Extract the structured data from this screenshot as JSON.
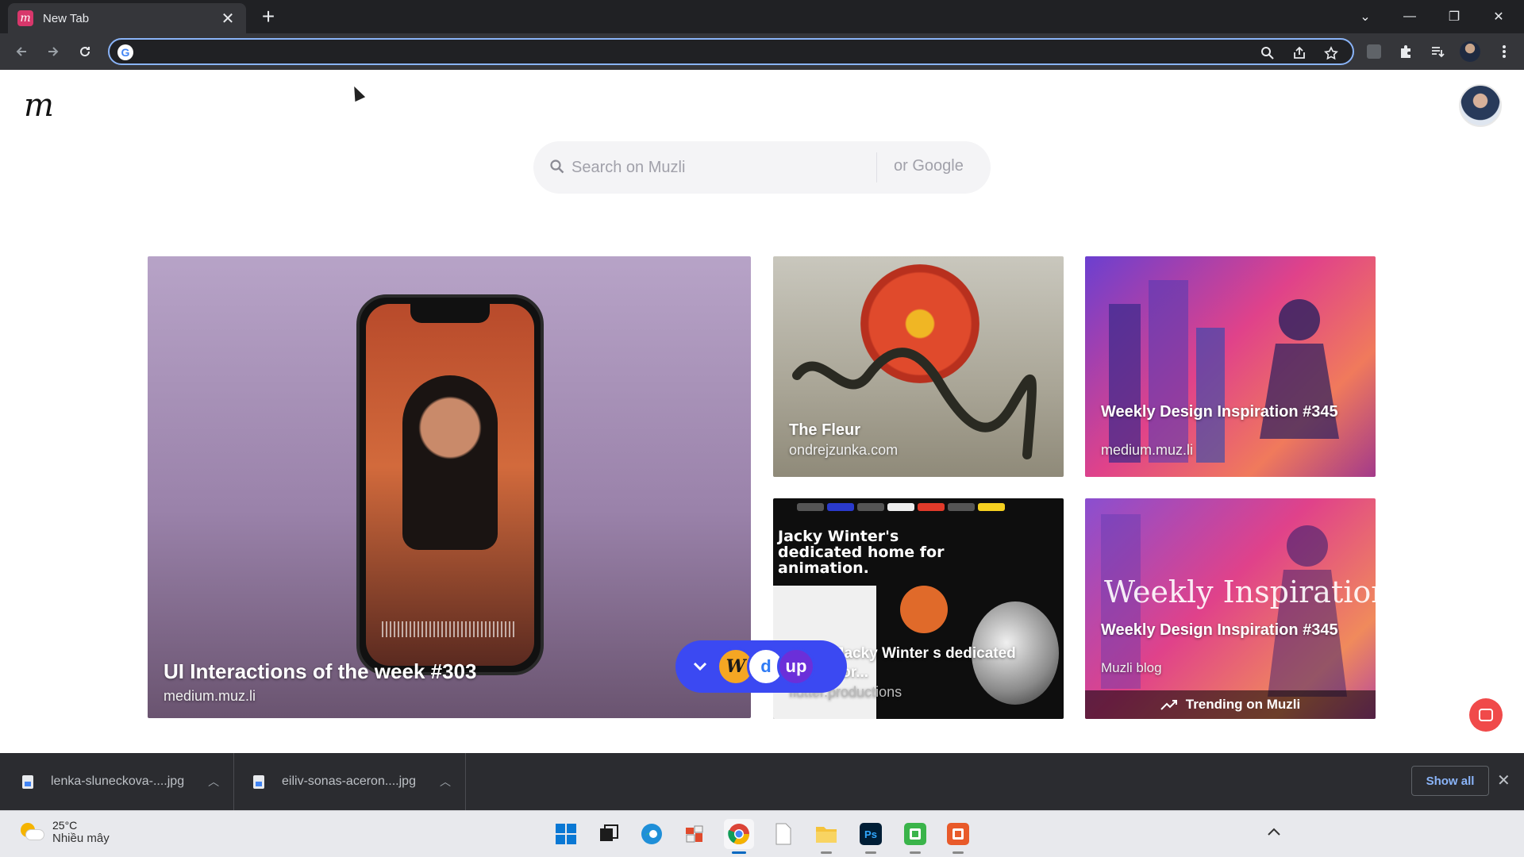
{
  "browser": {
    "tab_title": "New Tab",
    "new_tab_symbol": "+",
    "close_symbol": "✕",
    "address_value": "",
    "window_controls": [
      "⌄",
      "—",
      "❐",
      "✕"
    ]
  },
  "page": {
    "logo": "m",
    "search": {
      "placeholder": "Search on Muzli",
      "alt_engine": "or Google"
    },
    "cards": {
      "big": {
        "title": "UI Interactions of the week #303",
        "source": "medium.muz.li"
      },
      "fleur": {
        "title": "The Fleur",
        "source": "ondrejzunka.com"
      },
      "weekly": {
        "title": "Weekly Design Inspiration #345",
        "source": "medium.muz.li"
      },
      "jacky": {
        "image_text": "Jacky Winter's dedicated home for animation.",
        "title": "– The Jacky Winter s dedicated home for...",
        "source": "flutter.productions"
      },
      "trending": {
        "image_text": "Weekly Inspiration",
        "title": "Weekly Design Inspiration #345",
        "source": "Muzli blog",
        "badge": "Trending on Muzli"
      }
    },
    "floatbar": {
      "apps": [
        {
          "name": "W",
          "color": "#f5a623",
          "text_color": "#1a1a1a"
        },
        {
          "name": "d",
          "color": "#ffffff",
          "text_color": "#2f7bf5"
        },
        {
          "name": "up",
          "color": "#6b2fd9",
          "text_color": "#ffffff"
        }
      ]
    }
  },
  "downloads": {
    "items": [
      {
        "filename": "lenka-sluneckova-....jpg"
      },
      {
        "filename": "eiliv-sonas-aceron....jpg"
      }
    ],
    "show_all": "Show all"
  },
  "taskbar": {
    "weather_temp": "25°C",
    "weather_desc": "Nhiều mây",
    "apps": [
      "windows-start",
      "task-view",
      "edge",
      "photos",
      "chrome",
      "notepad",
      "file-explorer",
      "photoshop",
      "camtasia",
      "camtasia-recorder"
    ]
  },
  "colors": {
    "accent": "#8ab4f8",
    "floatbar": "#3b49f2",
    "chat": "#f04a4a",
    "muzli_tab": "#d8376b"
  }
}
